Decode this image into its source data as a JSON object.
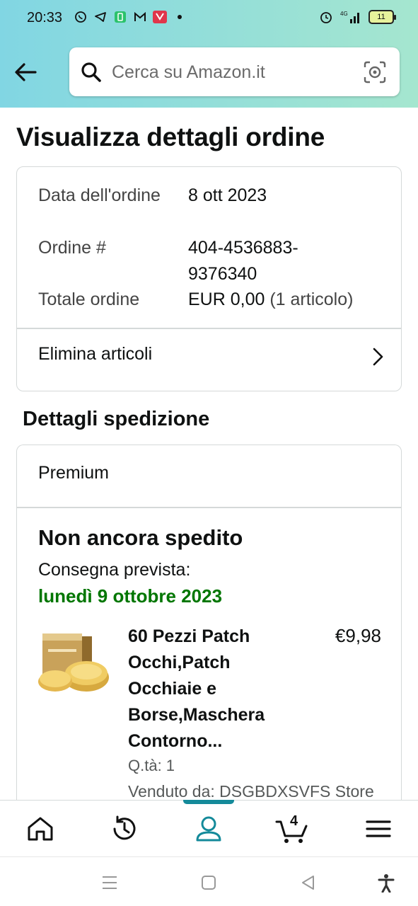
{
  "status_bar": {
    "time": "20:33",
    "network": "4G",
    "battery": "11"
  },
  "search": {
    "placeholder": "Cerca su Amazon.it"
  },
  "page_title": "Visualizza dettagli ordine",
  "order_summary": {
    "date_label": "Data dell'ordine",
    "date_value": "8 ott 2023",
    "number_label": "Ordine #",
    "number_value": "404-4536883-9376340",
    "total_label": "Totale ordine",
    "total_value": "EUR 0,00",
    "total_items": "(1 articolo)",
    "delete_items_label": "Elimina articoli"
  },
  "shipping": {
    "section_title": "Dettagli spedizione",
    "shipping_type": "Premium",
    "status": "Non ancora spedito",
    "delivery_label": "Consegna prevista:",
    "delivery_date": "lunedì 9 ottobre 2023",
    "product": {
      "title": "60 Pezzi Patch Occhi,Patch Occhiaie e Borse,Maschera Contorno...",
      "price": "€9,98",
      "quantity": "Q.tà: 1",
      "seller": "Venduto da: DSGBDXSVFS Store"
    }
  },
  "bottom_nav": {
    "cart_count": "4",
    "active": "account"
  },
  "colors": {
    "header_gradient_start": "#81d6e3",
    "header_gradient_end": "#a5e6cf",
    "delivery_green": "#007600",
    "active_teal": "#148a9a"
  }
}
